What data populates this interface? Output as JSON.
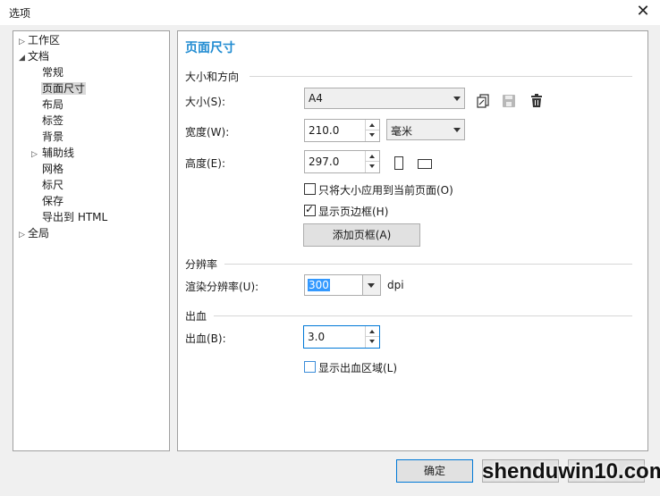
{
  "window": {
    "title": "选项"
  },
  "tree": [
    {
      "label": "工作区",
      "arrow": "▷",
      "indent": 0
    },
    {
      "label": "文档",
      "arrow": "◢",
      "indent": 0
    },
    {
      "label": "常规",
      "arrow": "",
      "indent": 2
    },
    {
      "label": "页面尺寸",
      "arrow": "",
      "indent": 2,
      "selected": true
    },
    {
      "label": "布局",
      "arrow": "",
      "indent": 2
    },
    {
      "label": "标签",
      "arrow": "",
      "indent": 2
    },
    {
      "label": "背景",
      "arrow": "",
      "indent": 2
    },
    {
      "label": "辅助线",
      "arrow": "▷",
      "indent": 1
    },
    {
      "label": "网格",
      "arrow": "",
      "indent": 2
    },
    {
      "label": "标尺",
      "arrow": "",
      "indent": 2
    },
    {
      "label": "保存",
      "arrow": "",
      "indent": 2
    },
    {
      "label": "导出到 HTML",
      "arrow": "",
      "indent": 2
    },
    {
      "label": "全局",
      "arrow": "▷",
      "indent": 0
    }
  ],
  "panel": {
    "title": "页面尺寸",
    "size_section": {
      "title": "大小和方向",
      "size_label": "大小(S):",
      "size_value": "A4",
      "width_label": "宽度(W):",
      "width_value": "210.0",
      "unit_value": "毫米",
      "height_label": "高度(E):",
      "height_value": "297.0",
      "apply_current_label": "只将大小应用到当前页面(O)",
      "apply_current_checked": false,
      "show_border_label": "显示页边框(H)",
      "show_border_checked": true,
      "add_border_button": "添加页框(A)"
    },
    "resolution_section": {
      "title": "分辨率",
      "render_label": "渲染分辨率(U):",
      "render_value": "300",
      "unit": "dpi"
    },
    "bleed_section": {
      "title": "出血",
      "bleed_label": "出血(B):",
      "bleed_value": "3.0",
      "show_bleed_label": "显示出血区域(L)",
      "show_bleed_checked": false
    }
  },
  "buttons": {
    "ok": "确定"
  },
  "watermark": "shenduwin10.com",
  "icons": {
    "custom_page": "custom-page-icon",
    "save": "save-icon",
    "delete": "trash-icon"
  }
}
